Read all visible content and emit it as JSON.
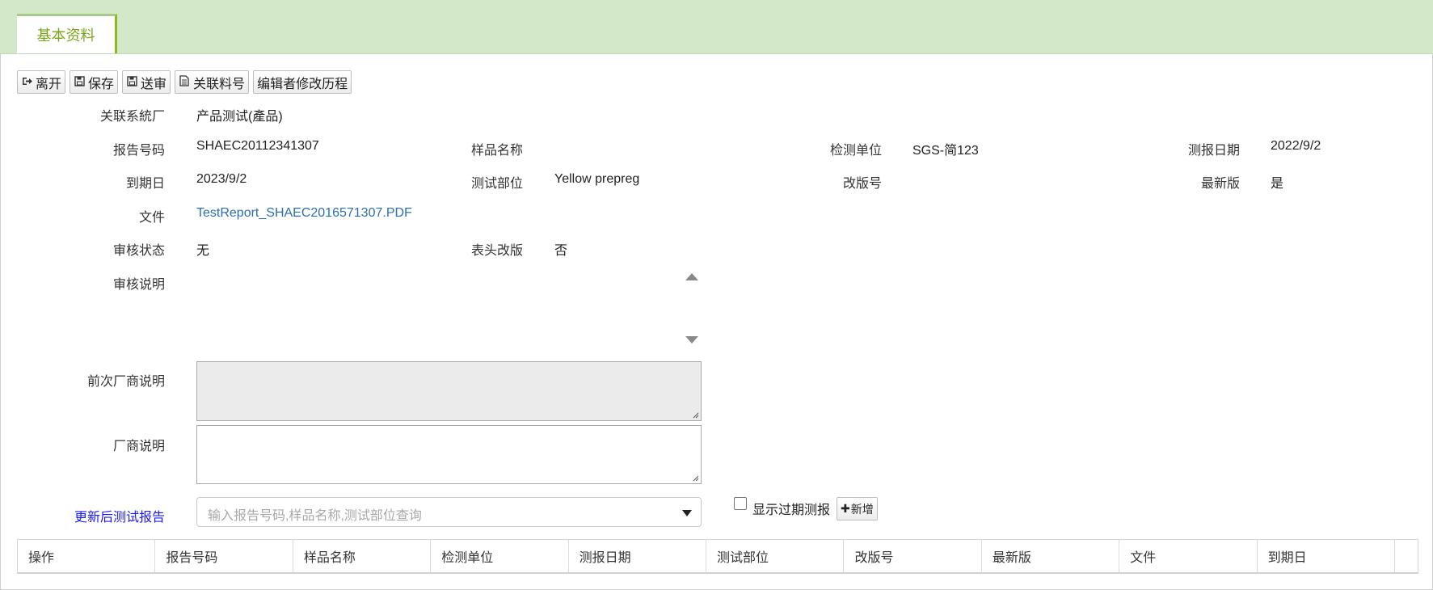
{
  "tabs": [
    {
      "label": "基本资料"
    }
  ],
  "toolbar": {
    "leave": "离开",
    "save": "保存",
    "submit": "送审",
    "related_part": "关联料号",
    "edit_history": "编辑者修改历程"
  },
  "form": {
    "factory": {
      "label": "关联系統厂",
      "value": "产品测试(產品)"
    },
    "report_no": {
      "label": "报告号码",
      "value": "SHAEC20112341307"
    },
    "sample_name": {
      "label": "样品名称",
      "value": ""
    },
    "test_unit": {
      "label": "检测单位",
      "value": "SGS-简123"
    },
    "report_date": {
      "label": "测报日期",
      "value": "2022/9/2"
    },
    "expiry": {
      "label": "到期日",
      "value": "2023/9/2"
    },
    "test_part": {
      "label": "测试部位",
      "value": "Yellow prepreg"
    },
    "revision": {
      "label": "改版号",
      "value": ""
    },
    "latest": {
      "label": "最新版",
      "value": "是"
    },
    "file": {
      "label": "文件",
      "value": "TestReport_SHAEC2016571307.PDF"
    },
    "review_status": {
      "label": "审核状态",
      "value": "无"
    },
    "header_revision": {
      "label": "表头改版",
      "value": "否"
    },
    "review_note": {
      "label": "审核说明",
      "value": ""
    },
    "prev_vendor_note": {
      "label": "前次厂商说明",
      "value": ""
    },
    "vendor_note": {
      "label": "厂商说明",
      "value": ""
    },
    "updated_report": {
      "label": "更新后测试报告",
      "placeholder": "输入报告号码,样品名称,测试部位查询"
    },
    "show_expired": {
      "label": "显示过期测报",
      "checked": false
    },
    "add_button": "新增"
  },
  "table": {
    "columns": [
      "操作",
      "报告号码",
      "样品名称",
      "检测单位",
      "测报日期",
      "测试部位",
      "改版号",
      "最新版",
      "文件",
      "到期日"
    ]
  },
  "colors": {
    "tabbar_bg": "#d3e8c8",
    "tab_text": "#7aa519",
    "link": "#2a6fb4",
    "blue_label": "#1a1aff"
  }
}
